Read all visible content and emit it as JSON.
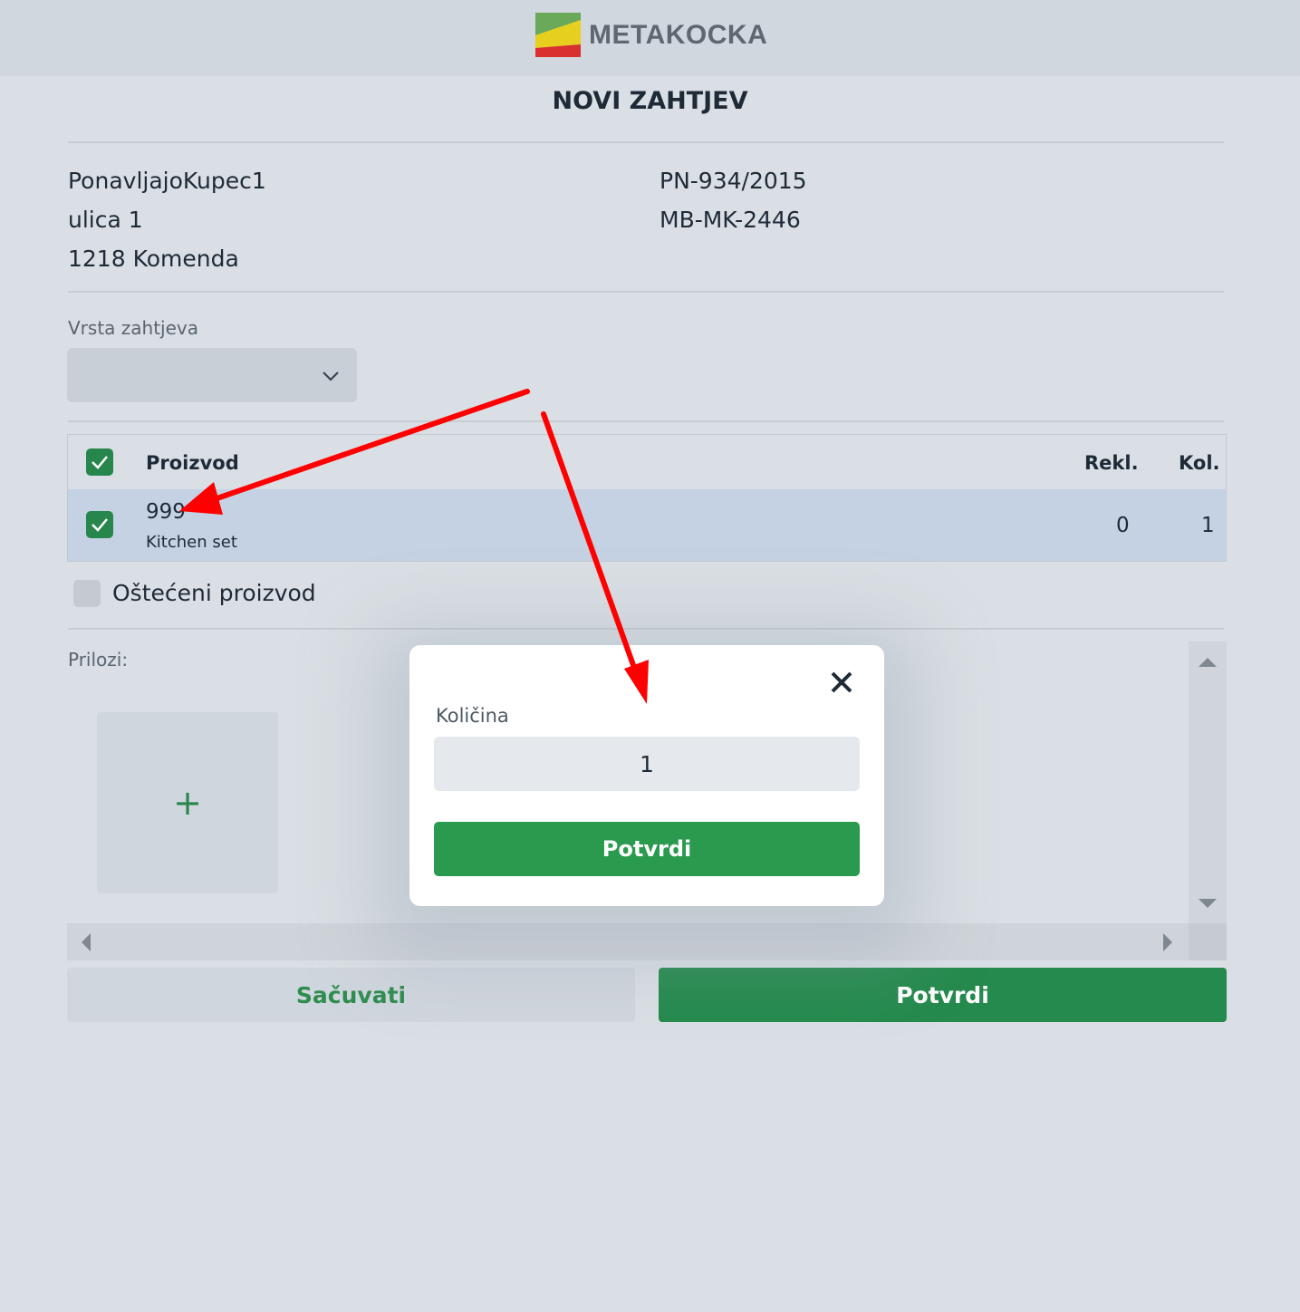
{
  "header": {
    "logo_text": "METAKOCKA"
  },
  "page": {
    "title": "NOVI ZAHTJEV"
  },
  "customer": {
    "name": "PonavljajoKupec1",
    "street": "ulica 1",
    "city": "1218 Komenda",
    "doc_number": "PN-934/2015",
    "doc_code": "MB-MK-2446"
  },
  "request_type": {
    "label": "Vrsta zahtjeva",
    "value": ""
  },
  "table": {
    "headers": {
      "product": "Proizvod",
      "rekl": "Rekl.",
      "kol": "Kol."
    },
    "rows": [
      {
        "code": "999",
        "name": "Kitchen set",
        "rekl": "0",
        "kol": "1",
        "checked": true
      }
    ]
  },
  "damaged": {
    "label": "Oštećeni proizvod",
    "checked": false
  },
  "attachments": {
    "label": "Prilozi:",
    "add_symbol": "+"
  },
  "actions": {
    "save_label": "Sačuvati",
    "confirm_label": "Potvrdi"
  },
  "modal": {
    "label": "Količina",
    "quantity": "1",
    "confirm_label": "Potvrdi"
  },
  "colors": {
    "primary_green": "#258a4d",
    "annotation_red": "#ff0000"
  }
}
